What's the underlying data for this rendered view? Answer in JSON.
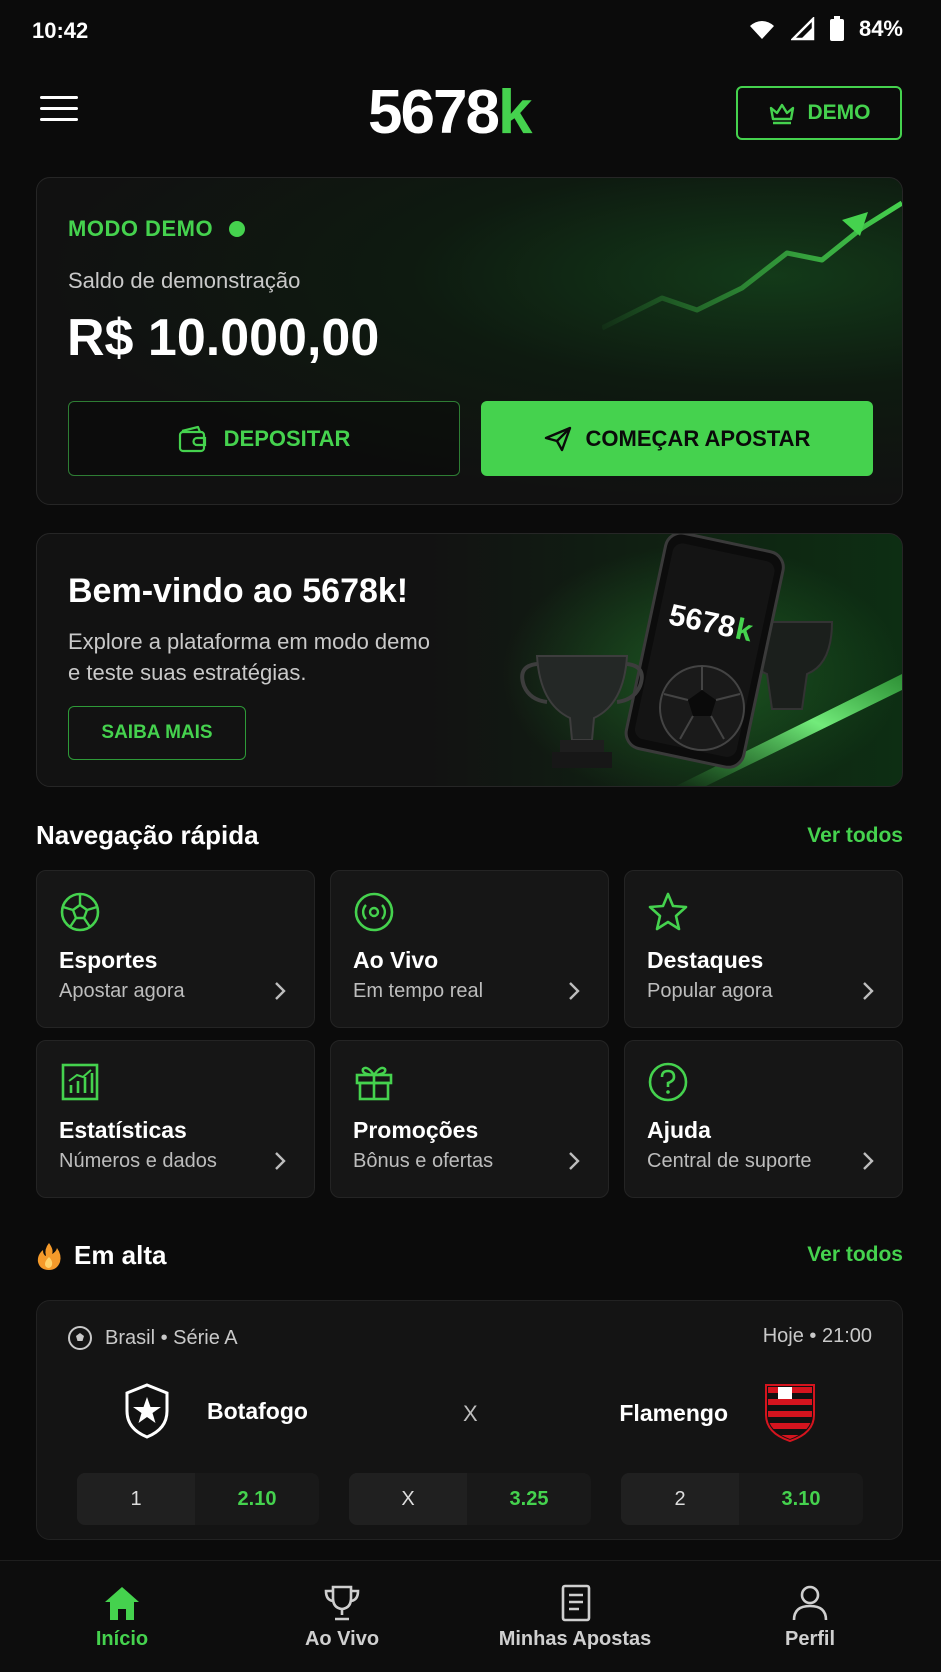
{
  "status_bar": {
    "time": "10:42",
    "battery": "84%"
  },
  "header": {
    "logo_main": "5678",
    "logo_accent": "k",
    "demo_label": "DEMO"
  },
  "demo_card": {
    "mode_label": "MODO DEMO",
    "balance_label": "Saldo de demonstração",
    "balance_value": "R$ 10.000,00",
    "deposit_label": "DEPOSITAR",
    "start_label": "COMEÇAR APOSTAR"
  },
  "welcome": {
    "title": "Bem-vindo ao 5678k!",
    "text": "Explore a plataforma em modo demo e teste suas estratégias.",
    "button": "SAIBA MAIS",
    "phone_logo_main": "5678",
    "phone_logo_accent": "k"
  },
  "quick_nav": {
    "title": "Navegação rápida",
    "see_all": "Ver todos",
    "items": [
      {
        "title": "Esportes",
        "subtitle": "Apostar agora",
        "icon": "soccer-ball-icon"
      },
      {
        "title": "Ao Vivo",
        "subtitle": "Em tempo real",
        "icon": "live-broadcast-icon"
      },
      {
        "title": "Destaques",
        "subtitle": "Popular agora",
        "icon": "star-icon"
      },
      {
        "title": "Estatísticas",
        "subtitle": "Números e dados",
        "icon": "chart-icon"
      },
      {
        "title": "Promoções",
        "subtitle": "Bônus e ofertas",
        "icon": "gift-icon"
      },
      {
        "title": "Ajuda",
        "subtitle": "Central de suporte",
        "icon": "help-icon"
      }
    ]
  },
  "trending": {
    "title": "Em alta",
    "see_all": "Ver todos",
    "match": {
      "league": "Brasil • Série A",
      "time": "Hoje • 21:00",
      "home": "Botafogo",
      "away": "Flamengo",
      "vs": "X",
      "odds": [
        {
          "label": "1",
          "value": "2.10"
        },
        {
          "label": "X",
          "value": "3.25"
        },
        {
          "label": "2",
          "value": "3.10"
        }
      ]
    }
  },
  "bottom_nav": {
    "items": [
      {
        "label": "Início",
        "icon": "home-icon",
        "active": true
      },
      {
        "label": "Ao Vivo",
        "icon": "trophy-icon",
        "active": false
      },
      {
        "label": "Minhas Apostas",
        "icon": "receipt-icon",
        "active": false
      },
      {
        "label": "Perfil",
        "icon": "user-icon",
        "active": false
      }
    ]
  },
  "colors": {
    "accent": "#45d24e",
    "background": "#0b0b0b",
    "card": "#161616"
  }
}
